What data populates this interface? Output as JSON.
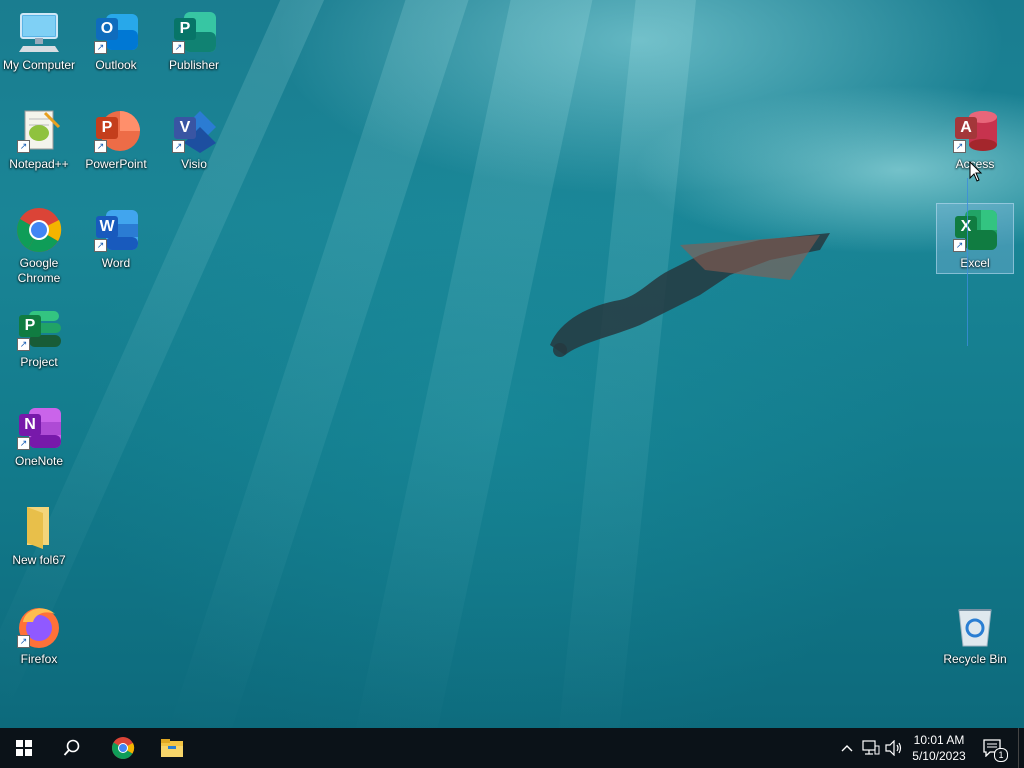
{
  "desktop": {
    "icons": [
      {
        "name": "my-computer",
        "label": "My Computer",
        "icon": "computer-icon"
      },
      {
        "name": "outlook",
        "label": "Outlook",
        "icon": "outlook-icon",
        "letter": "O",
        "color": "#0f6cbd"
      },
      {
        "name": "publisher",
        "label": "Publisher",
        "icon": "publisher-icon",
        "letter": "P",
        "color": "#077568"
      },
      {
        "name": "notepadpp",
        "label": "Notepad++",
        "icon": "notepadpp-icon"
      },
      {
        "name": "powerpoint",
        "label": "PowerPoint",
        "icon": "powerpoint-icon",
        "letter": "P",
        "color": "#c43e1c"
      },
      {
        "name": "visio",
        "label": "Visio",
        "icon": "visio-icon",
        "letter": "V",
        "color": "#3955a3"
      },
      {
        "name": "google-chrome",
        "label": "Google Chrome",
        "icon": "chrome-icon"
      },
      {
        "name": "word",
        "label": "Word",
        "icon": "word-icon",
        "letter": "W",
        "color": "#185abd"
      },
      {
        "name": "project",
        "label": "Project",
        "icon": "project-icon",
        "letter": "P",
        "color": "#107c41"
      },
      {
        "name": "onenote",
        "label": "OneNote",
        "icon": "onenote-icon",
        "letter": "N",
        "color": "#7719aa"
      },
      {
        "name": "new-folder",
        "label": "New fol67",
        "icon": "folder-icon"
      },
      {
        "name": "firefox",
        "label": "Firefox",
        "icon": "firefox-icon"
      },
      {
        "name": "access",
        "label": "Access",
        "icon": "access-icon",
        "letter": "A",
        "color": "#a4373a"
      },
      {
        "name": "excel",
        "label": "Excel",
        "icon": "excel-icon",
        "letter": "X",
        "color": "#107c41",
        "selected": true
      },
      {
        "name": "recycle-bin",
        "label": "Recycle Bin",
        "icon": "recycle-bin-icon"
      }
    ]
  },
  "taskbar": {
    "start": {
      "icon": "windows-start-icon"
    },
    "search": {
      "icon": "search-icon"
    },
    "pinned": [
      {
        "name": "chrome",
        "icon": "chrome-icon"
      },
      {
        "name": "file-explorer",
        "icon": "file-explorer-icon"
      }
    ],
    "tray": {
      "chevron_icon": "chevron-up-icon",
      "network_icon": "network-icon",
      "volume_icon": "volume-icon"
    },
    "clock": {
      "time": "10:01 AM",
      "date": "5/10/2023"
    },
    "notifications": {
      "icon": "notification-icon",
      "count": "1"
    }
  }
}
